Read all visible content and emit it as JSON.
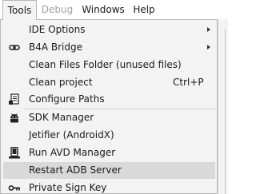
{
  "menubar": {
    "items": [
      {
        "label": "Tools",
        "state": "active"
      },
      {
        "label": "Debug",
        "state": "disabled"
      },
      {
        "label": "Windows",
        "state": "normal"
      },
      {
        "label": "Help",
        "state": "normal"
      }
    ]
  },
  "tools_menu": {
    "items": [
      {
        "label": "IDE Options",
        "has_submenu": true,
        "icon": ""
      },
      {
        "label": "B4A Bridge",
        "has_submenu": true,
        "icon": "link-icon"
      },
      {
        "label": "Clean Files Folder (unused files)",
        "icon": ""
      },
      {
        "label": "Clean project",
        "shortcut": "Ctrl+P",
        "icon": ""
      },
      {
        "label": "Configure Paths",
        "icon": "document-icon"
      },
      {
        "label": "SDK Manager",
        "icon": "android-icon"
      },
      {
        "label": "Jetifier (AndroidX)",
        "icon": ""
      },
      {
        "label": "Run AVD Manager",
        "icon": "phone-icon"
      },
      {
        "label": "Restart ADB Server",
        "highlighted": true,
        "icon": ""
      },
      {
        "label": "Private Sign Key",
        "icon": "key-icon"
      }
    ]
  },
  "colors": {
    "menu_background": "#f3f3f3",
    "highlight": "#d9d9d9",
    "border": "#b9b9b9",
    "disabled_text": "#a0a0a0"
  }
}
